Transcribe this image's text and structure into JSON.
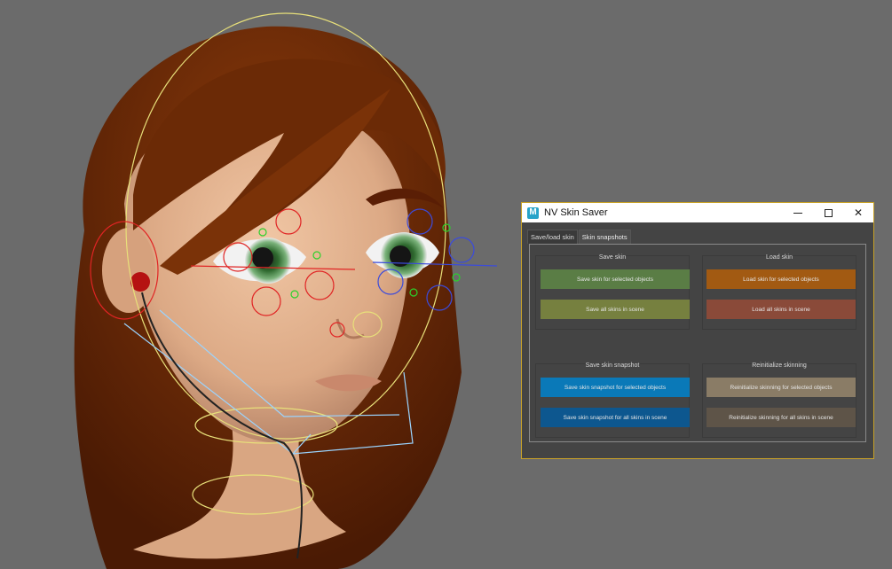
{
  "dialog": {
    "title": "NV Skin Saver",
    "app_icon_letter": "M",
    "tabs": [
      {
        "label": "Save/load skin",
        "active": false
      },
      {
        "label": "Skin snapshots",
        "active": true
      }
    ],
    "sections": {
      "save_skin": {
        "title": "Save skin",
        "buttons": [
          "Save skin for selected objects",
          "Save all skins in scene"
        ]
      },
      "load_skin": {
        "title": "Load skin",
        "buttons": [
          "Load skin for selected objects",
          "Load all skins in scene"
        ]
      },
      "save_snapshot": {
        "title": "Save skin snapshot",
        "buttons": [
          "Save skin snapshot for selected objects",
          "Save skin snapshot for all skins in scene"
        ]
      },
      "reinit": {
        "title": "Reinitialize skinning",
        "buttons": [
          "Reinitialize skinning for selected objects",
          "Reinitialize skinning for all skins in scene"
        ]
      }
    }
  },
  "colors": {
    "viewport_bg": "#6b6b6b",
    "dialog_border": "#c9a227",
    "save_selected": "#5a7d45",
    "save_all": "#76803f",
    "load_selected": "#a25a12",
    "load_all": "#8a4a39",
    "snapshot_selected": "#0a79b8",
    "snapshot_all": "#0d578f",
    "reinit_selected": "#8a7c66",
    "reinit_all": "#5e5448"
  }
}
